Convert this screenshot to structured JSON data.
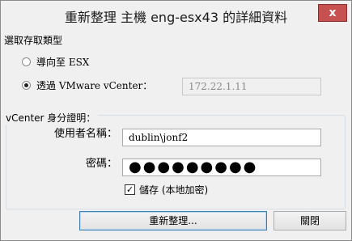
{
  "window": {
    "title": "重新整理 主機 eng-esx43 的詳細資料",
    "close_label": "x"
  },
  "access_type": {
    "group_label": "選取存取類型",
    "options": [
      {
        "label": "導向至 ESX",
        "selected": false
      },
      {
        "label": "透過 VMware vCenter：",
        "selected": true
      }
    ],
    "vcenter_address": "172.22.1.11"
  },
  "credentials": {
    "group_label": "vCenter 身分證明：",
    "username_label": "使用者名稱：",
    "username_value": "dublin\\jonf2",
    "password_label": "密碼：",
    "password_masked": "●●●●●●●●●",
    "save_label": "儲存 (本地加密)",
    "save_checked": true,
    "check_mark": "✓"
  },
  "buttons": {
    "refresh": "重新整理...",
    "close": "關閉"
  }
}
